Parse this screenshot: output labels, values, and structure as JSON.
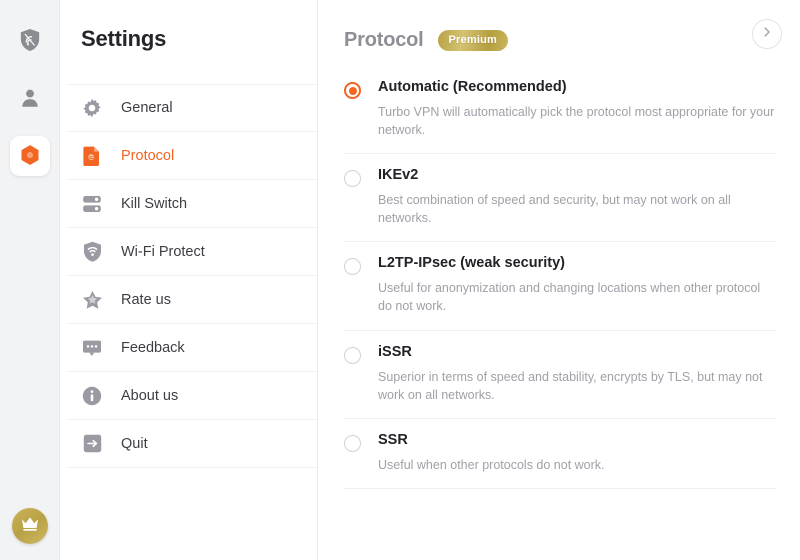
{
  "rail": {
    "items": [
      {
        "name": "shield-vpn-icon",
        "label": "VPN Shield",
        "active": false
      },
      {
        "name": "account-icon",
        "label": "Account",
        "active": false
      },
      {
        "name": "hexagon-settings-icon",
        "label": "Settings",
        "active": true
      }
    ],
    "bottom": {
      "name": "crown-icon",
      "label": "Premium Upgrade"
    }
  },
  "settings": {
    "title": "Settings",
    "items": [
      {
        "label": "General",
        "icon": "gear-icon",
        "selected": false
      },
      {
        "label": "Protocol",
        "icon": "document-icon",
        "selected": true
      },
      {
        "label": "Kill Switch",
        "icon": "server-icon",
        "selected": false
      },
      {
        "label": "Wi-Fi Protect",
        "icon": "shield-wifi-icon",
        "selected": false
      },
      {
        "label": "Rate us",
        "icon": "star-icon",
        "selected": false
      },
      {
        "label": "Feedback",
        "icon": "chat-bubble-icon",
        "selected": false
      },
      {
        "label": "About us",
        "icon": "info-icon",
        "selected": false
      },
      {
        "label": "Quit",
        "icon": "exit-arrow-icon",
        "selected": false
      }
    ]
  },
  "main": {
    "title": "Protocol",
    "badge": "Premium",
    "next_icon": "chevron-right-icon",
    "options": [
      {
        "title": "Automatic (Recommended)",
        "desc": "Turbo VPN will automatically pick the protocol most appropriate for your network.",
        "selected": true
      },
      {
        "title": "IKEv2",
        "desc": "Best combination of speed and security, but may not work on all networks.",
        "selected": false
      },
      {
        "title": "L2TP-IPsec (weak security)",
        "desc": "Useful for anonymization and changing locations when other protocol do not work.",
        "selected": false
      },
      {
        "title": "iSSR",
        "desc": "Superior in terms of speed and stability, encrypts by TLS, but may not work on all networks.",
        "selected": false
      },
      {
        "title": "SSR",
        "desc": "Useful when other protocols do not work.",
        "selected": false
      }
    ]
  },
  "colors": {
    "accent": "#f26522",
    "premium_gold": "#b9a145",
    "rail_bg": "#f2f3f5",
    "muted_text": "#a0a0a8"
  }
}
